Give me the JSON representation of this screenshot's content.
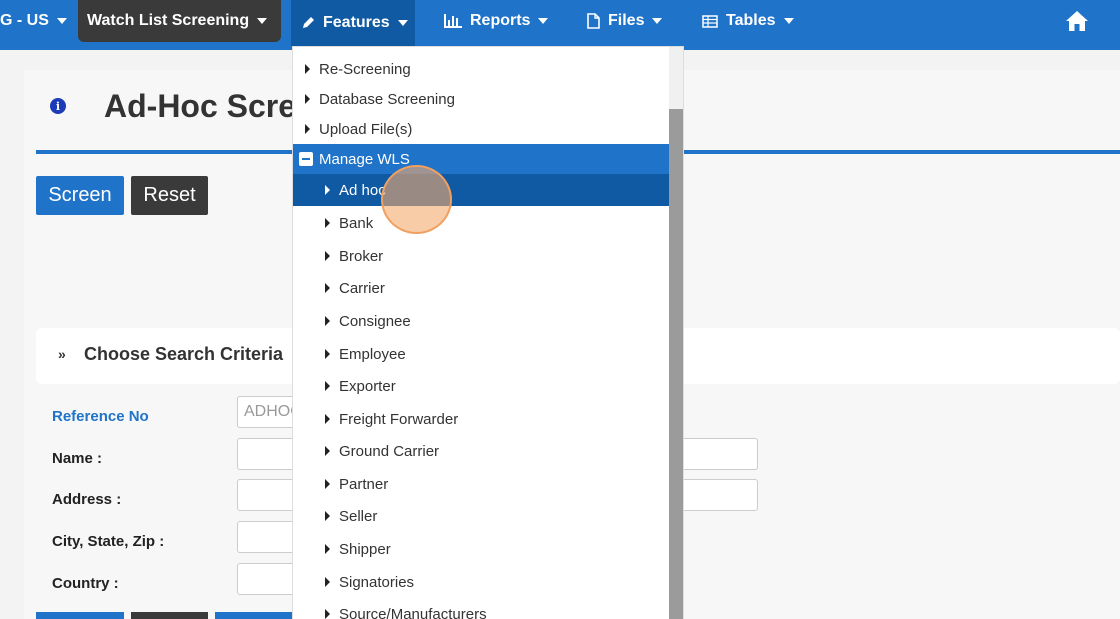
{
  "nav": {
    "org_label": "G - US",
    "wls_label": "Watch List Screening",
    "features_label": "Features",
    "reports_label": "Reports",
    "files_label": "Files",
    "tables_label": "Tables"
  },
  "page": {
    "title": "Ad-Hoc Scre",
    "screen_button": "Screen",
    "reset_button": "Reset",
    "criteria_title": "Choose Search Criteria"
  },
  "form": {
    "reference_label": "Reference No",
    "reference_value": "ADHOC",
    "name_label": "Name :",
    "address_label": "Address :",
    "city_label": "City, State, Zip :",
    "country_label": "Country :"
  },
  "dropdown": {
    "items_top": [
      "Re-Screening",
      "Database Screening",
      "Upload File(s)"
    ],
    "manage_label": "Manage WLS",
    "sub_items": [
      "Ad hoc",
      "Bank",
      "Broker",
      "Carrier",
      "Consignee",
      "Employee",
      "Exporter",
      "Freight Forwarder",
      "Ground Carrier",
      "Partner",
      "Seller",
      "Shipper",
      "Signatories",
      "Source/Manufacturers"
    ],
    "active_item": "Ad hoc"
  },
  "colors": {
    "nav_blue": "#1f73c8",
    "nav_dark": "#3a3a3a",
    "active_blue": "#0f5aa3"
  },
  "icons": {
    "features": "pencil-icon",
    "reports": "bar-chart-icon",
    "files": "file-icon",
    "tables": "table-icon",
    "home": "home-icon",
    "info": "info-icon"
  }
}
